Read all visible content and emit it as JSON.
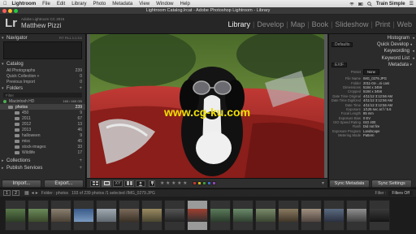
{
  "menubar": {
    "items": [
      "Lightroom",
      "File",
      "Edit",
      "Library",
      "Photo",
      "Metadata",
      "View",
      "Window",
      "Help"
    ],
    "right_label": "Train Simple"
  },
  "window": {
    "title": "Lightroom Catalog.lrcat - Adobe Photoshop Lightroom - Library"
  },
  "identity": {
    "logo": "Lr",
    "catalog_name": "Adobe Lightroom CC 2015",
    "user_name": "Matthew Pizzi"
  },
  "modules": [
    "Library",
    "Develop",
    "Map",
    "Book",
    "Slideshow",
    "Print",
    "Web"
  ],
  "left_panel": {
    "navigator_label": "Navigator",
    "navigator_zoom": "FIT  FILL  1:1  3:1",
    "catalog_items": [
      {
        "label": "All Photographs",
        "count": "239"
      },
      {
        "label": "Quick Collection +",
        "count": "0"
      },
      {
        "label": "Previous Import",
        "count": "0"
      }
    ],
    "folders_label": "Folders",
    "filter_placeholder": "Filter",
    "drive": {
      "label": "Macintosh HD",
      "size": "165 / 465 GB"
    },
    "folders": [
      {
        "label": "photos",
        "count": "239",
        "indent": 10
      },
      {
        "label": "450",
        "count": "9",
        "indent": 18
      },
      {
        "label": "2011",
        "count": "67",
        "indent": 18
      },
      {
        "label": "2012",
        "count": "13",
        "indent": 18
      },
      {
        "label": "2013",
        "count": "46",
        "indent": 18
      },
      {
        "label": "halloween",
        "count": "9",
        "indent": 18
      },
      {
        "label": "misc",
        "count": "45",
        "indent": 18
      },
      {
        "label": "stock-images",
        "count": "33",
        "indent": 18
      },
      {
        "label": "Wildlife",
        "count": "17",
        "indent": 18
      }
    ],
    "collections_label": "Collections",
    "publish_label": "Publish Services",
    "import_label": "Import...",
    "export_label": "Export..."
  },
  "center": {
    "watermark": "www.cg-ku.com"
  },
  "toolbar": {
    "stars": "★ ★ ★ ★ ★",
    "label_colors": [
      "#c0392b",
      "#d4b21a",
      "#3c9a3c",
      "#3a6fc4",
      "#8e44ad"
    ]
  },
  "right_panel": {
    "histogram_label": "Histogram",
    "quick_develop_label": "Quick Develop",
    "quick_develop_preset": "Defaults",
    "keywording_label": "Keywording",
    "keyword_list_label": "Keyword List",
    "metadata_label": "Metadata",
    "metadata_view": "EXIF",
    "preset_key": "Preset",
    "preset_value": "None",
    "metadata_rows": [
      {
        "k": "File Name",
        "v": "IMG_0279.JPG"
      },
      {
        "k": "Folder",
        "v": "2011-04-...ni cars"
      },
      {
        "k": "Dimensions",
        "v": "5184 x 3456"
      },
      {
        "k": "Cropped",
        "v": "5184 x 3456"
      },
      {
        "k": "Date Time Original",
        "v": "4/11/12 3:12:56 AM"
      },
      {
        "k": "Date Time Digitized",
        "v": "4/11/12 3:12:56 AM"
      },
      {
        "k": "Date Time",
        "v": "4/11/12 3:12:56 AM"
      },
      {
        "k": "Exposure",
        "v": "1/125 sec at f / 5.6"
      },
      {
        "k": "Focal Length",
        "v": "85 mm"
      },
      {
        "k": "Exposure Bias",
        "v": "0 EV"
      },
      {
        "k": "ISO Speed Rating",
        "v": "ISO 400"
      },
      {
        "k": "Flash",
        "v": "Did not fire"
      },
      {
        "k": "Exposure Program",
        "v": "Landscape"
      },
      {
        "k": "Metering Mode",
        "v": "Pattern"
      }
    ],
    "sync_label": "Sync Metadata",
    "sync_settings_label": "Sync Settings"
  },
  "filmstrip_bar": {
    "page1": "1",
    "page2": "2",
    "source": "Folder : photos",
    "count_text": "193 of 239 photos /1 selected /IMG_0279.JPG",
    "filter_label": "Filter :",
    "filter_value": "Filters Off"
  },
  "filmstrip": {
    "thumbs": [
      {
        "c1": "#5a7a4a",
        "c2": "#2d3d25"
      },
      {
        "c1": "#6a8a5a",
        "c2": "#3a4a2a"
      },
      {
        "c1": "#8a8070",
        "c2": "#4a4035"
      },
      {
        "c1": "#3a5a8a",
        "c2": "#7a9ac0"
      },
      {
        "c1": "#a0a8b0",
        "c2": "#606870"
      },
      {
        "c1": "#7a6a5a",
        "c2": "#3a3025"
      },
      {
        "c1": "#9a8a60",
        "c2": "#4a4530"
      },
      {
        "c1": "#555555",
        "c2": "#222222"
      },
      {
        "c1": "#a04030",
        "c2": "#303030"
      },
      {
        "c1": "#5a7a5a",
        "c2": "#2a3a2a"
      },
      {
        "c1": "#6a8a6a",
        "c2": "#304030"
      },
      {
        "c1": "#7a8a6a",
        "c2": "#3a4530"
      },
      {
        "c1": "#8a7a60",
        "c2": "#403528"
      },
      {
        "c1": "#a09080",
        "c2": "#504540"
      },
      {
        "c1": "#5a6a80",
        "c2": "#2a3040"
      },
      {
        "c1": "#909090",
        "c2": "#404040"
      },
      {
        "c1": "#3a3a3a",
        "c2": "#151515"
      }
    ],
    "selected_index": 8
  }
}
